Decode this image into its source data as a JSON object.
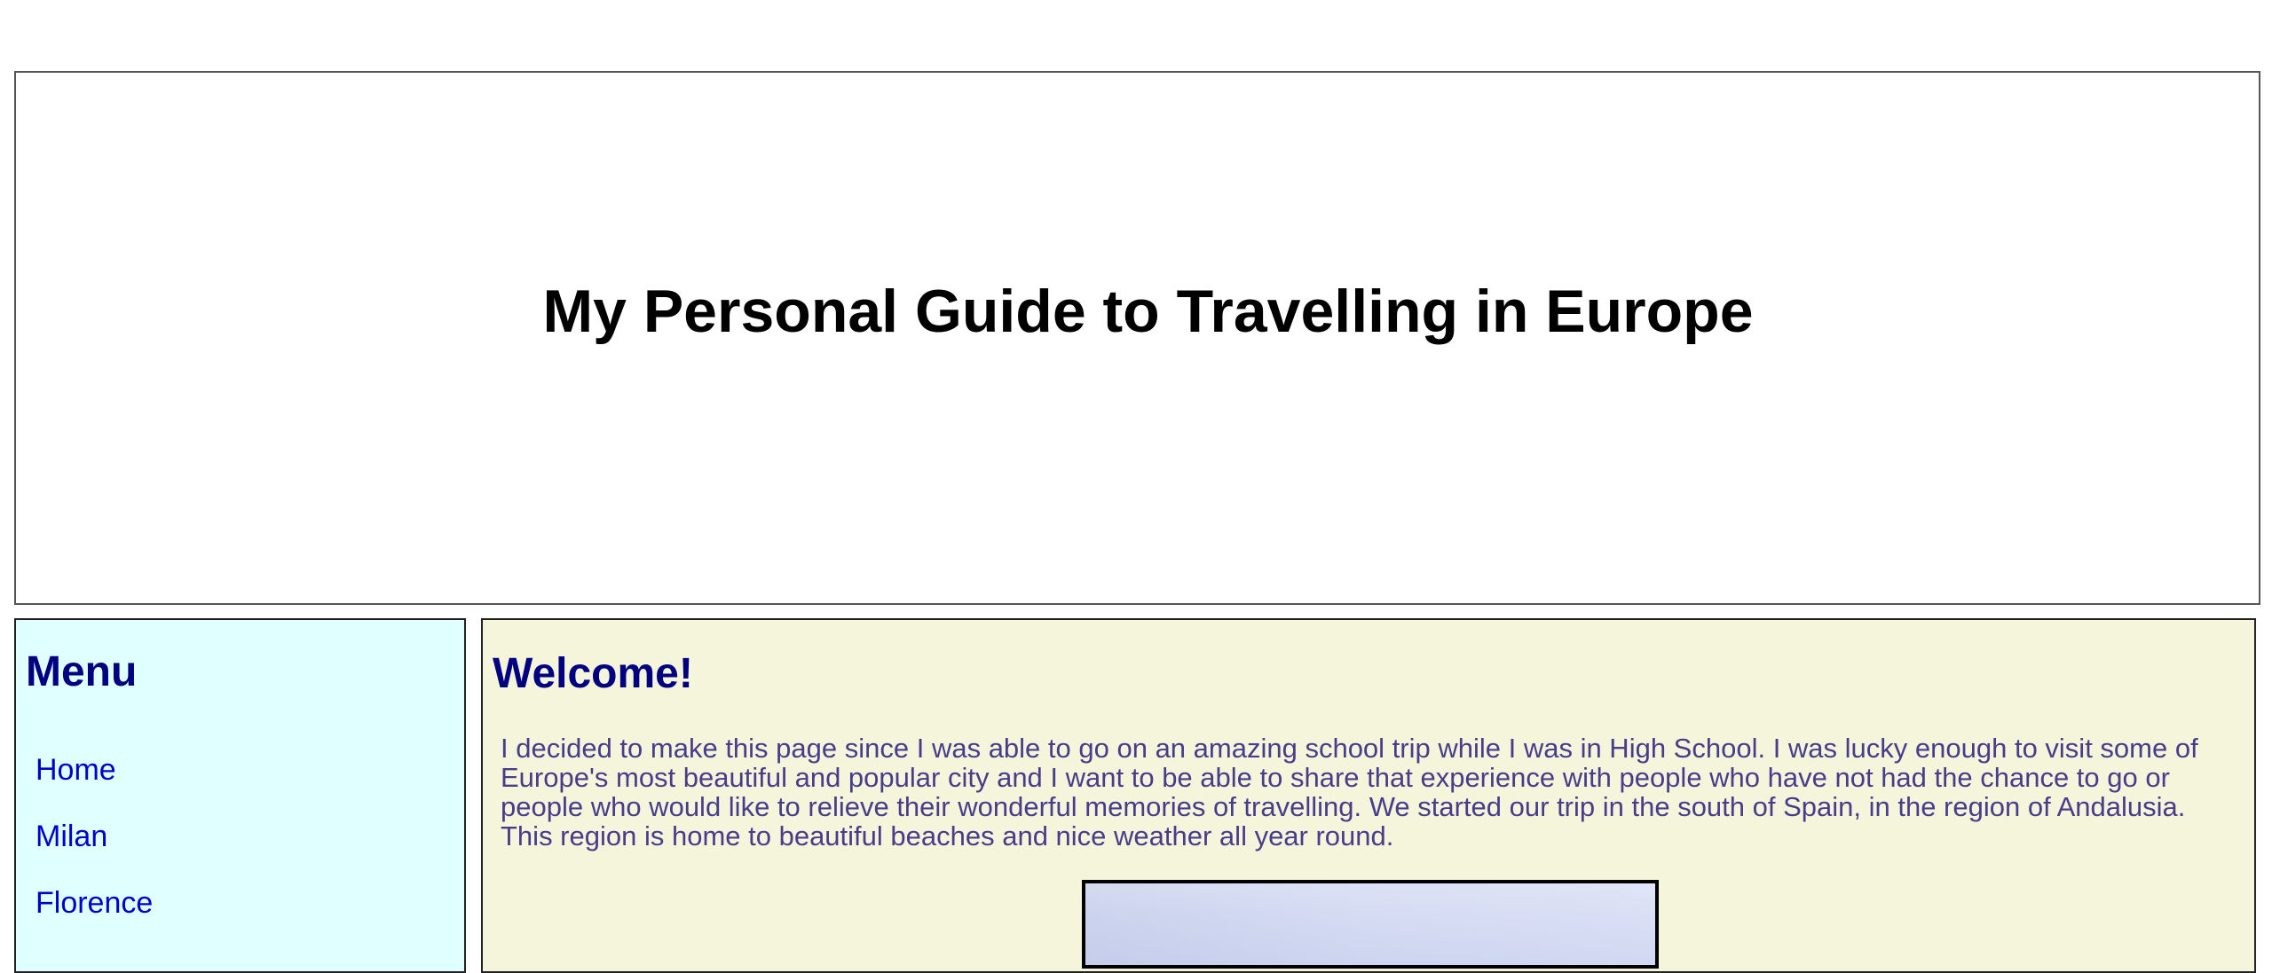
{
  "header": {
    "title": "My Personal Guide to Travelling in Europe"
  },
  "sidebar": {
    "title": "Menu",
    "items": [
      {
        "label": "Home"
      },
      {
        "label": "Milan"
      },
      {
        "label": "Florence"
      }
    ]
  },
  "main": {
    "title": "Welcome!",
    "paragraph": "I decided to make this page since I was able to go on an amazing school trip while I was in High School. I was lucky enough to visit some of Europe's most beautiful and popular city and I want to be able to share that experience with people who have not had the chance to go or people who would like to relieve their wonderful memories of travelling. We started our trip in the south of Spain, in the region of Andalusia. This region is home to beautiful beaches and nice weather all year round.",
    "image": {
      "icon": "landscape-photo"
    }
  },
  "colors": {
    "header_background": "#ffffff",
    "sidebar_background": "#e0ffff",
    "main_background": "#f5f5dc",
    "heading": "#000080",
    "link": "#0000cc",
    "body_text": "#483d8b"
  }
}
